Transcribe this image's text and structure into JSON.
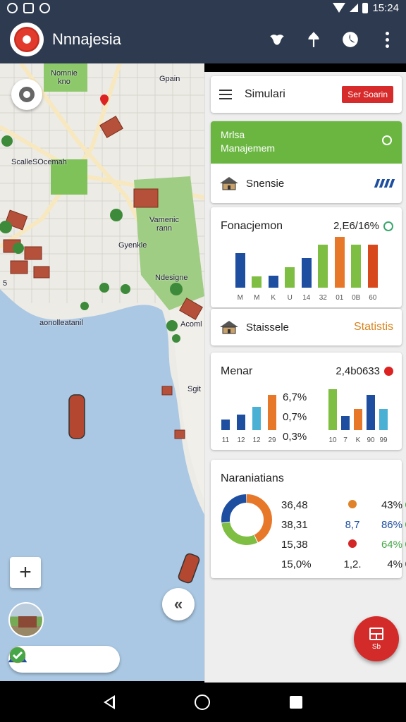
{
  "status_bar": {
    "time": "15:24"
  },
  "app_bar": {
    "title": "Nnnajesia",
    "icons": [
      "bird-icon",
      "pin-icon",
      "half-circle-icon",
      "more-vert-icon"
    ]
  },
  "map": {
    "labels": {
      "park_top": "Nomnie\nkno",
      "gpain": "Gpain",
      "scaile": "ScalleSOcemah",
      "vamenic": "Vamenic\nrann",
      "gyenkle": "Gyenkle",
      "ndesign": "Ndesigne",
      "acom": "Acoml",
      "aonolle": "aonolleatanil",
      "sgit": "Sgit",
      "five": "5"
    }
  },
  "panel": {
    "simulation": {
      "label": "Simulari",
      "button": "Ser Soarin"
    },
    "management": {
      "title_line1": "Mrlsa",
      "title_line2": "Manajemem",
      "row_label": "Snensie"
    },
    "function_chart": {
      "title": "Fonacjemon",
      "value": "2,E6/16%",
      "ticks": [
        "M",
        "M",
        "K",
        "U",
        "14",
        "32",
        "01",
        "0B",
        "60"
      ]
    },
    "statistics": {
      "label": "Staissele",
      "link": "Statistis"
    },
    "menar": {
      "title": "Menar",
      "value": "2,4b0633",
      "ticks_left": [
        "11",
        "12",
        "12",
        "29"
      ],
      "percentages": [
        "6,7%",
        "0,7%",
        "0,3%"
      ],
      "ticks_right": [
        "10",
        "7",
        "K",
        "90",
        "99"
      ]
    },
    "narrations": {
      "title": "Naraniatians",
      "rows": [
        {
          "a": "36,48",
          "b": "",
          "c": "43%",
          "dot": "#e0822a",
          "mark": "ok"
        },
        {
          "a": "38,31",
          "b": "8,7",
          "c": "86%",
          "dot": "",
          "mark": "ok"
        },
        {
          "a": "15,38",
          "b": "",
          "c": "64%",
          "dot": "#d32626",
          "mark": "ok"
        },
        {
          "a": "15,0%",
          "b": "1,2.",
          "c": "4%",
          "dot": "",
          "mark": "empty"
        }
      ]
    },
    "fab_label": "Sb"
  },
  "colors": {
    "header_bg": "#2d3a4f",
    "accent_red": "#d72a2a",
    "accent_green": "#6ab640",
    "water": "#aac8e3",
    "series_blue": "#1e4ea0",
    "series_green": "#7ebe42",
    "series_orange": "#e7782a",
    "series_red": "#d8481d",
    "series_cyan": "#4ab0d4"
  },
  "chart_data": [
    {
      "type": "bar",
      "title": "Fonacjemon",
      "categories": [
        "M",
        "M",
        "K",
        "U",
        "14",
        "32",
        "01",
        "0B",
        "60"
      ],
      "values": [
        50,
        16,
        17,
        30,
        43,
        63,
        74,
        63,
        63
      ],
      "colors": [
        "#1e4ea0",
        "#7ebe42",
        "#1e4ea0",
        "#7ebe42",
        "#1e4ea0",
        "#7ebe42",
        "#e7782a",
        "#7ebe42",
        "#d8481d"
      ]
    },
    {
      "type": "bar",
      "title": "Menar",
      "categories": [
        "11",
        "12",
        "12",
        "29"
      ],
      "values": [
        15,
        22,
        33,
        50
      ],
      "colors": [
        "#1e4ea0",
        "#1e4ea0",
        "#4ab0d4",
        "#e7782a"
      ]
    },
    {
      "type": "bar",
      "categories": [
        "10",
        "7",
        "K",
        "90",
        "99"
      ],
      "values": [
        58,
        20,
        30,
        50,
        30
      ],
      "colors": [
        "#7ebe42",
        "#1e4ea0",
        "#e7782a",
        "#1e4ea0",
        "#4ab0d4"
      ]
    },
    {
      "type": "pie",
      "title": "Naraniatians",
      "values": [
        43,
        30,
        27
      ],
      "colors": [
        "#e7782a",
        "#7ebe42",
        "#1e4ea0"
      ]
    }
  ]
}
